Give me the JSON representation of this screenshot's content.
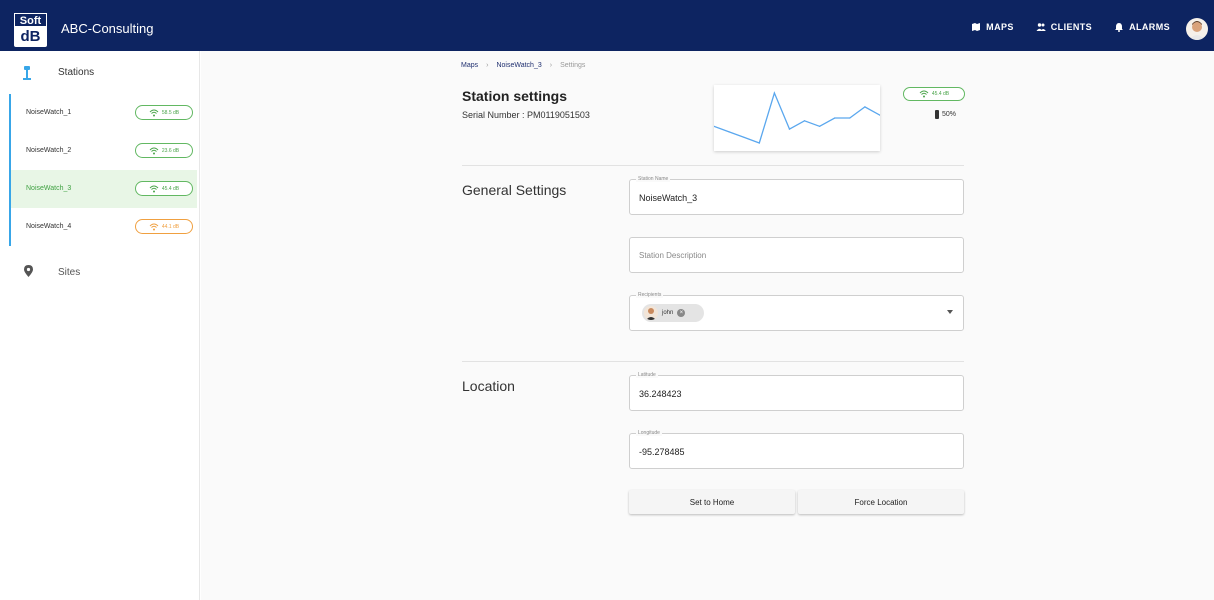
{
  "app": {
    "logo_top": "Soft",
    "logo_bottom": "dB",
    "company": "ABC-Consulting"
  },
  "nav": {
    "items": [
      {
        "label": "MAPS",
        "icon": "map-icon"
      },
      {
        "label": "CLIENTS",
        "icon": "people-icon"
      },
      {
        "label": "ALARMS",
        "icon": "bell-icon"
      }
    ]
  },
  "sidebar": {
    "stations_label": "Stations",
    "sites_label": "Sites",
    "stations": [
      {
        "name": "NoiseWatch_1",
        "level": "58.5 dB",
        "status": "good"
      },
      {
        "name": "NoiseWatch_2",
        "level": "23.6 dB",
        "status": "good"
      },
      {
        "name": "NoiseWatch_3",
        "level": "45.4 dB",
        "status": "good",
        "active": true
      },
      {
        "name": "NoiseWatch_4",
        "level": "44.1 dB",
        "status": "warning"
      }
    ]
  },
  "breadcrumb": {
    "items": [
      "Maps",
      "NoiseWatch_3",
      "Settings"
    ]
  },
  "station": {
    "title": "Station settings",
    "serial": "Serial Number : PM0119051503",
    "signal": "45.4 dB",
    "battery": "50%"
  },
  "chart_data": {
    "type": "line",
    "values": [
      38,
      36,
      34,
      32,
      50,
      37,
      40,
      38,
      41,
      41,
      45,
      42
    ],
    "color": "#5aa7ee"
  },
  "general": {
    "title": "General Settings",
    "name_label": "Station Name",
    "name_value": "NoiseWatch_3",
    "desc_placeholder": "Station Description",
    "recipients_label": "Recipients",
    "recipient_chip": "john"
  },
  "location": {
    "title": "Location",
    "lat_label": "Latitude",
    "lat_value": "36.248423",
    "lon_label": "Longitude",
    "lon_value": "-95.278485",
    "home_button": "Set to Home",
    "force_button": "Force Location"
  },
  "colors": {
    "header": "#0d2461",
    "accent_green": "#4aa44a",
    "accent_orange": "#f0a040",
    "accent_blue": "#38a6e8"
  }
}
